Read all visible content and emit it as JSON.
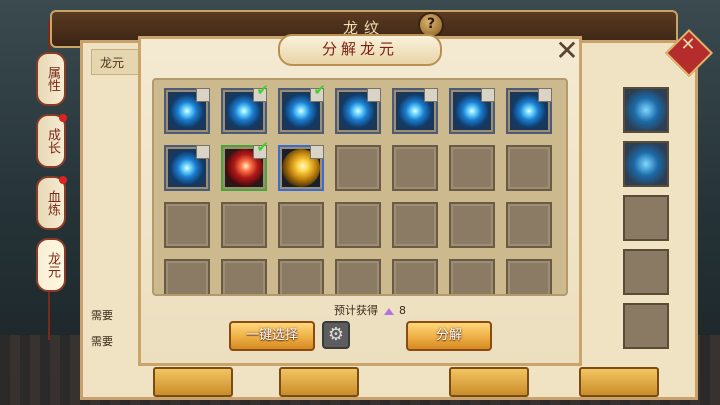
{
  "back_window": {
    "title": "龙纹",
    "help_label": "?",
    "panel_header": "龙元",
    "need_label_1": "需要",
    "need_label_2": "需要",
    "tabs": [
      {
        "label": "属性",
        "badge": false
      },
      {
        "label": "成长",
        "badge": true
      },
      {
        "label": "血炼",
        "badge": true
      },
      {
        "label": "龙元",
        "badge": false
      }
    ]
  },
  "dialog": {
    "title": "分解龙元",
    "close_label": "✕",
    "estimate_label": "预计获得",
    "estimate_value": "8",
    "select_all_label": "一键选择",
    "decompose_label": "分解",
    "settings_icon": "gear-icon"
  },
  "grid": {
    "columns": 7,
    "rows": [
      [
        {
          "item": "blue-orb",
          "selected": false
        },
        {
          "item": "blue-orb",
          "selected": true
        },
        {
          "item": "blue-orb",
          "selected": true
        },
        {
          "item": "blue-orb",
          "selected": false
        },
        {
          "item": "blue-orb",
          "selected": false
        },
        {
          "item": "blue-orb",
          "selected": false
        },
        {
          "item": "blue-orb",
          "selected": false
        }
      ],
      [
        {
          "item": "blue-orb",
          "selected": false
        },
        {
          "item": "red-orb",
          "selected": true
        },
        {
          "item": "gold-orb",
          "selected": false
        },
        {
          "item": "empty"
        },
        {
          "item": "empty"
        },
        {
          "item": "empty"
        },
        {
          "item": "empty"
        }
      ],
      [
        {
          "item": "empty"
        },
        {
          "item": "empty"
        },
        {
          "item": "empty"
        },
        {
          "item": "empty"
        },
        {
          "item": "empty"
        },
        {
          "item": "empty"
        },
        {
          "item": "empty"
        }
      ],
      [
        {
          "item": "empty"
        },
        {
          "item": "empty"
        },
        {
          "item": "empty"
        },
        {
          "item": "empty"
        },
        {
          "item": "empty"
        },
        {
          "item": "empty"
        },
        {
          "item": "empty"
        }
      ]
    ]
  },
  "colors": {
    "accent_gold": "#f0b24a",
    "check_green": "#3fd22a",
    "title_red": "#7b1f12"
  }
}
